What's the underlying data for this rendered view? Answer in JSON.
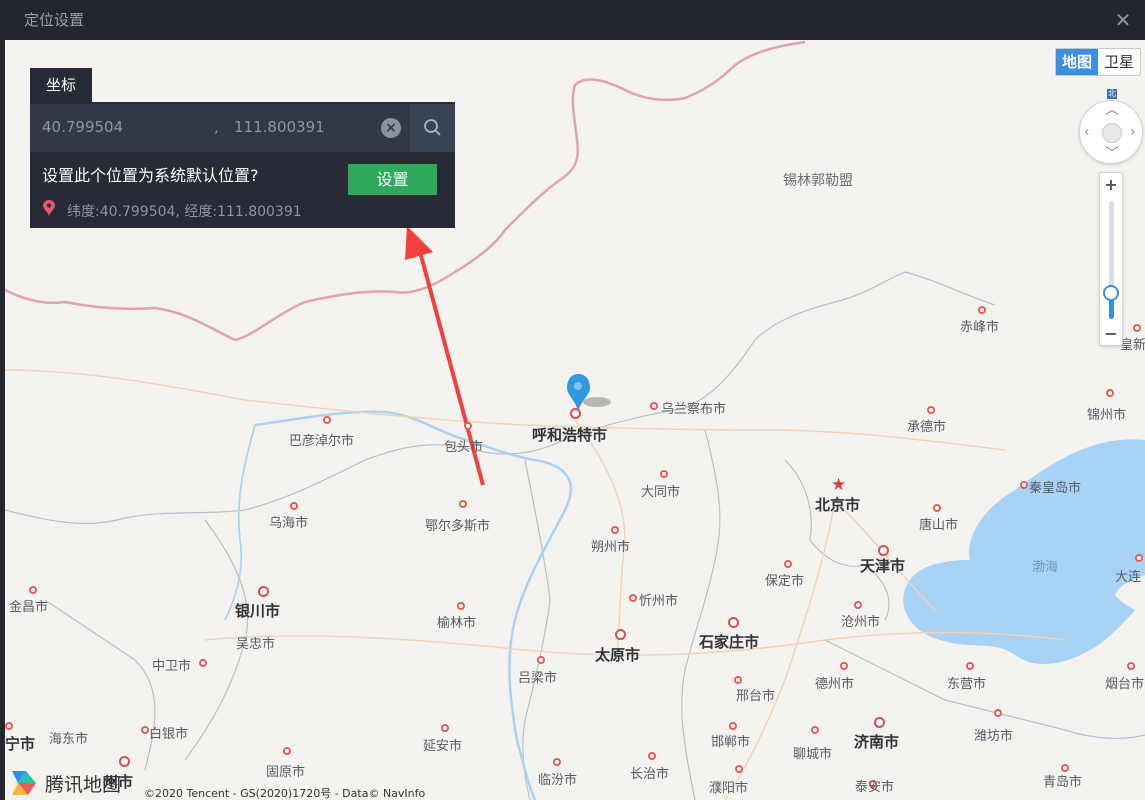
{
  "window": {
    "title": "定位设置",
    "close_glyph": "✕"
  },
  "map_type": {
    "options": [
      "地图",
      "卫星"
    ],
    "active": "地图"
  },
  "nav_control": {
    "north_label": "北"
  },
  "zoom": {
    "plus": "+",
    "minus": "−",
    "level_fraction": 0.2
  },
  "panel": {
    "tab_label": "坐标",
    "latitude": "40.799504",
    "separator": ",",
    "longitude": "111.800391",
    "question": "设置此个位置为系统默认位置?",
    "set_button": "设置",
    "info": "纬度:40.799504, 经度:111.800391"
  },
  "labels": {
    "xilinguole": "锡林郭勒盟",
    "chifeng": "赤峰市",
    "jinzhou": "锦州市",
    "chengde": "承德市",
    "qinhuangdao": "秦皇岛市",
    "tangshan": "唐山市",
    "beijing": "北京市",
    "tianjin": "天津市",
    "bohai": "渤海",
    "dalian": "大连",
    "huhehaote": "呼和浩特市",
    "wulanchabu": "乌兰察布市",
    "baotou": "包头市",
    "bayannaoer": "巴彦淖尔市",
    "datong": "大同市",
    "wuhai": "乌海市",
    "eerduosi": "鄂尔多斯市",
    "shuozhou": "朔州市",
    "baoding": "保定市",
    "cangzhou": "沧州市",
    "jinchang": "金昌市",
    "yinchuan": "银川市",
    "wuzhong": "吴忠市",
    "yulin": "榆林市",
    "xinzhou": "忻州市",
    "taiyuan": "太原市",
    "shijiazhuang": "石家庄市",
    "zhongwei": "中卫市",
    "lvliang": "吕梁市",
    "xingtai": "邢台市",
    "dezhou": "德州市",
    "dongying": "东营市",
    "yantai": "烟台市",
    "haidong": "海东市",
    "baiyin": "白银市",
    "yanan": "延安市",
    "handan": "邯郸市",
    "liaocheng": "聊城市",
    "jinan": "济南市",
    "weifang": "潍坊市",
    "guyuan": "固原市",
    "linfen": "临汾市",
    "changzhi": "长治市",
    "puyang": "濮阳市",
    "taian": "泰安市",
    "qingdao": "青岛市",
    "xining_partial": "宁市",
    "lanzhou_partial": "州市",
    "edge_r1": "皇新",
    "edge_r2": "锦州市"
  },
  "logo_text": "腾讯地图",
  "copyright": "©2020 Tencent - GS(2020)1720号 - Data© NavInfo",
  "colors": {
    "titlebar": "#23262e",
    "panel": "#262b36",
    "set_button": "#2daa5a",
    "accent": "#3a8fe0",
    "border_line": "#e1a3b0",
    "water": "#a8d3f5",
    "arrow": "#f2403c"
  }
}
